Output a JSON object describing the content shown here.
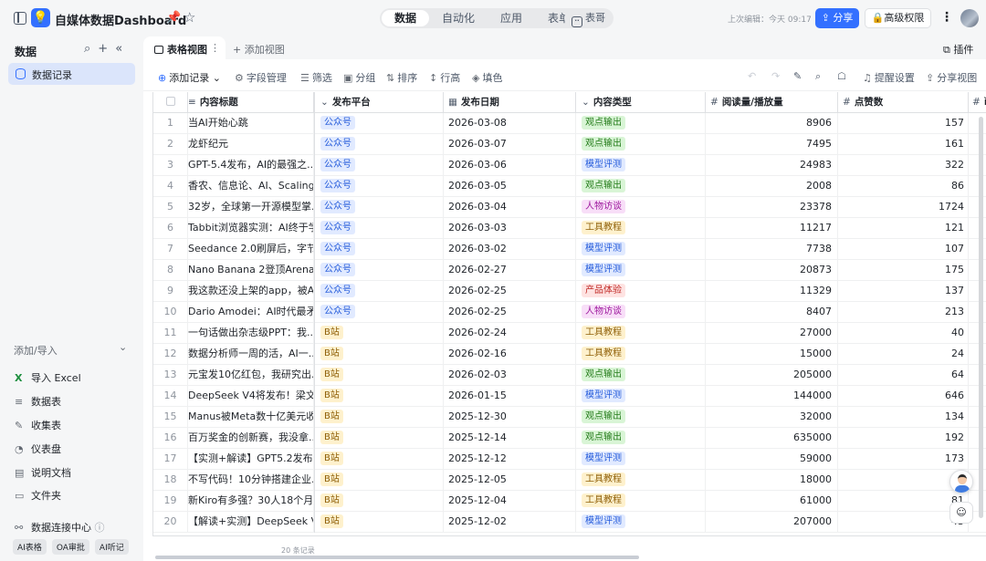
{
  "app": {
    "title": "自媒体数据Dashboard",
    "logo_icon": "bulb-icon"
  },
  "top_tabs": [
    {
      "label": "数据",
      "active": true
    },
    {
      "label": "自动化"
    },
    {
      "label": "应用"
    },
    {
      "label": "表单"
    }
  ],
  "ai_pill": {
    "icon": "ai-box-icon",
    "label": "表哥"
  },
  "last_edit": "上次编辑：今天 09:17",
  "share_label": "分享",
  "permission_label": "高级权限",
  "colors": {
    "accent": "#3370ff",
    "active_bg": "#dbe5fb"
  },
  "sidebar": {
    "title": "数据",
    "active_item": "数据记录",
    "add_import": "添加/导入",
    "items": [
      "导入 Excel",
      "数据表",
      "收集表",
      "仪表盘",
      "说明文档",
      "文件夹"
    ],
    "connect_center": "数据连接中心",
    "tags": [
      "AI表格",
      "OA审批",
      "AI听记"
    ]
  },
  "view": {
    "active_tab": "表格视图",
    "add_view": "+ 添加视图",
    "plugin": "插件"
  },
  "toolbar": {
    "add_record": "添加记录",
    "fields": "字段管理",
    "filter": "筛选",
    "group": "分组",
    "sort": "排序",
    "row_height": "行高",
    "fill": "填色",
    "remind": "提醒设置",
    "share_view": "分享视图"
  },
  "columns": {
    "title": "内容标题",
    "platform": "发布平台",
    "date": "发布日期",
    "type": "内容类型",
    "reads": "阅读量/播放量",
    "likes": "点赞数",
    "more": "ì"
  },
  "rows": [
    {
      "n": "1",
      "title": "当AI开始心跳",
      "platform": "公众号",
      "date": "2026-03-08",
      "type": "观点输出",
      "reads": "8906",
      "likes": "157"
    },
    {
      "n": "2",
      "title": "龙虾纪元",
      "platform": "公众号",
      "date": "2026-03-07",
      "type": "观点输出",
      "reads": "7495",
      "likes": "161"
    },
    {
      "n": "3",
      "title": "GPT-5.4发布，AI的最强之...",
      "platform": "公众号",
      "date": "2026-03-06",
      "type": "模型评测",
      "reads": "24983",
      "likes": "322"
    },
    {
      "n": "4",
      "title": "香农、信息论、AI、Scaling ...",
      "platform": "公众号",
      "date": "2026-03-05",
      "type": "观点输出",
      "reads": "2008",
      "likes": "86"
    },
    {
      "n": "5",
      "title": "32岁，全球第一开源模型掌...",
      "platform": "公众号",
      "date": "2026-03-04",
      "type": "人物访谈",
      "reads": "23378",
      "likes": "1724"
    },
    {
      "n": "6",
      "title": "Tabbit浏览器实测：AI终于学...",
      "platform": "公众号",
      "date": "2026-03-03",
      "type": "工具教程",
      "reads": "11217",
      "likes": "121"
    },
    {
      "n": "7",
      "title": "Seedance 2.0刷屏后，字节...",
      "platform": "公众号",
      "date": "2026-03-02",
      "type": "模型评测",
      "reads": "7738",
      "likes": "107"
    },
    {
      "n": "8",
      "title": "Nano Banana 2登顶Arena第...",
      "platform": "公众号",
      "date": "2026-02-27",
      "type": "模型评测",
      "reads": "20873",
      "likes": "175"
    },
    {
      "n": "9",
      "title": "我这款还没上架的app，被A...",
      "platform": "公众号",
      "date": "2026-02-25",
      "type": "产品体验",
      "reads": "11329",
      "likes": "137"
    },
    {
      "n": "10",
      "title": "Dario Amodei：AI时代最矛...",
      "platform": "公众号",
      "date": "2026-02-25",
      "type": "人物访谈",
      "reads": "8407",
      "likes": "213"
    },
    {
      "n": "11",
      "title": "一句话做出杂志级PPT：我...",
      "platform": "B站",
      "date": "2026-02-24",
      "type": "工具教程",
      "reads": "27000",
      "likes": "40"
    },
    {
      "n": "12",
      "title": "数据分析师一周的活，AI一...",
      "platform": "B站",
      "date": "2026-02-16",
      "type": "工具教程",
      "reads": "15000",
      "likes": "24"
    },
    {
      "n": "13",
      "title": "元宝发10亿红包，我研究出...",
      "platform": "B站",
      "date": "2026-02-03",
      "type": "观点输出",
      "reads": "205000",
      "likes": "64"
    },
    {
      "n": "14",
      "title": "DeepSeek V4将发布！梁文...",
      "platform": "B站",
      "date": "2026-01-15",
      "type": "模型评测",
      "reads": "144000",
      "likes": "646"
    },
    {
      "n": "15",
      "title": "Manus被Meta数十亿美元收...",
      "platform": "B站",
      "date": "2025-12-30",
      "type": "观点输出",
      "reads": "32000",
      "likes": "134"
    },
    {
      "n": "16",
      "title": "百万奖金的创新赛，我没拿...",
      "platform": "B站",
      "date": "2025-12-14",
      "type": "观点输出",
      "reads": "635000",
      "likes": "192"
    },
    {
      "n": "17",
      "title": "【实测+解读】GPT5.2发布...",
      "platform": "B站",
      "date": "2025-12-12",
      "type": "模型评测",
      "reads": "59000",
      "likes": "173"
    },
    {
      "n": "18",
      "title": "不写代码！10分钟搭建企业...",
      "platform": "B站",
      "date": "2025-12-05",
      "type": "工具教程",
      "reads": "18000",
      "likes": "27"
    },
    {
      "n": "19",
      "title": "新Kiro有多强？30人18个月...",
      "platform": "B站",
      "date": "2025-12-04",
      "type": "工具教程",
      "reads": "61000",
      "likes": "81"
    },
    {
      "n": "20",
      "title": "【解读+实测】DeepSeek V...",
      "platform": "B站",
      "date": "2025-12-02",
      "type": "模型评测",
      "reads": "207000",
      "likes": "43"
    }
  ],
  "record_count": "20 条记录"
}
